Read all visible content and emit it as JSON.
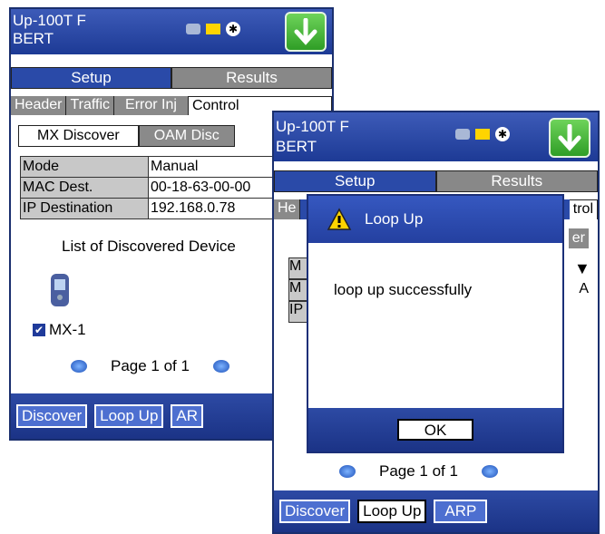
{
  "screen_left": {
    "title_line1": "Up-100T F",
    "title_line2": "BERT",
    "tabs": [
      "Setup",
      "Results"
    ],
    "subtabs": [
      "Header",
      "Traffic",
      "Error Inj",
      "Control"
    ],
    "subsubtabs": [
      "MX Discover",
      "OAM Disc"
    ],
    "rows": [
      {
        "key": "Mode",
        "value": "Manual"
      },
      {
        "key": "MAC Dest.",
        "value": "00-18-63-00-00"
      },
      {
        "key": "IP Destination",
        "value": "192.168.0.78"
      }
    ],
    "list_heading": "List of Discovered Device",
    "device_label": "MX-1",
    "page_text": "Page 1 of 1",
    "buttons": [
      "Discover",
      "Loop Up",
      "AR"
    ]
  },
  "screen_right": {
    "title_line1": "Up-100T F",
    "title_line2": "BERT",
    "tabs": [
      "Setup",
      "Results"
    ],
    "subtab_left_fragment": "He",
    "subtab_right_fragment": "trol",
    "subsub_right_fragment": "er",
    "row_key_fragments": [
      "M",
      "M",
      "IP"
    ],
    "row_value_fragments": [
      "",
      "A",
      ""
    ],
    "page_text": "Page 1 of 1",
    "buttons": [
      "Discover",
      "Loop Up",
      "ARP"
    ]
  },
  "dialog": {
    "title": "Loop Up",
    "message": "loop up successfully",
    "ok_label": "OK"
  },
  "colors": {
    "title_bar": "#2a4aa8",
    "accent_green": "#3aaa2e",
    "inactive_tab": "#888888"
  }
}
